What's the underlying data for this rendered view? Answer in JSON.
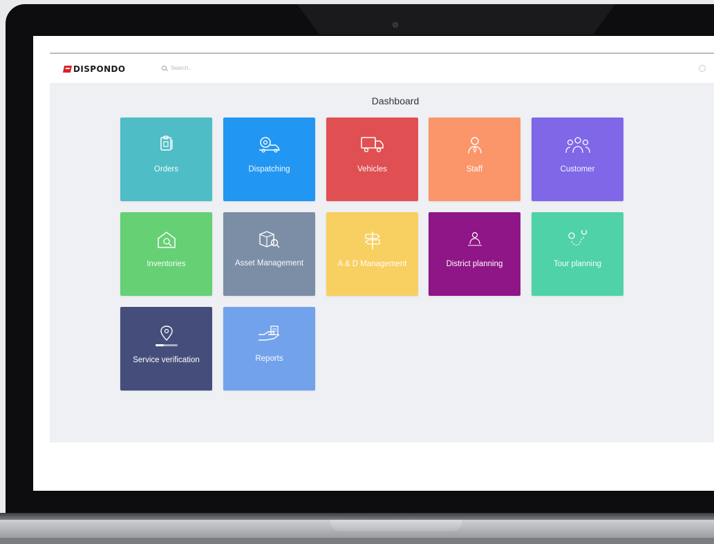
{
  "app": {
    "logo_text": "DISPONDO",
    "search_placeholder": "Search...",
    "page_title": "Dashboard"
  },
  "tiles": [
    {
      "label": "Orders",
      "color": "#4ebdc6",
      "icon": "clipboard-icon"
    },
    {
      "label": "Dispatching",
      "color": "#2196f3",
      "icon": "dispatch-icon"
    },
    {
      "label": "Vehicles",
      "color": "#e04f52",
      "icon": "truck-icon"
    },
    {
      "label": "Staff",
      "color": "#fb966b",
      "icon": "person-icon"
    },
    {
      "label": "Customer",
      "color": "#7f67e8",
      "icon": "group-icon"
    },
    {
      "label": "Inventories",
      "color": "#66d075",
      "icon": "warehouse-icon"
    },
    {
      "label": "Asset Management",
      "color": "#7c8ea6",
      "icon": "box-search-icon"
    },
    {
      "label": "A & D Management",
      "color": "#f8cf61",
      "icon": "signpost-icon"
    },
    {
      "label": "District planning",
      "color": "#8e1686",
      "icon": "map-person-icon"
    },
    {
      "label": "Tour planning",
      "color": "#4fd2a8",
      "icon": "route-icon"
    },
    {
      "label": "Service verification",
      "color": "#454e7b",
      "icon": "location-pin-icon"
    },
    {
      "label": "Reports",
      "color": "#73a2ec",
      "icon": "hand-document-icon"
    }
  ]
}
